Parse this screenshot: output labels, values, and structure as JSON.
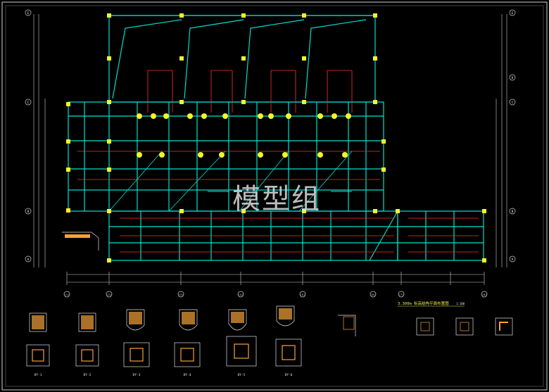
{
  "watermark": "模型组",
  "plan_title": "3.300m 标高结构平面布置图",
  "plan_scale": "1:100",
  "grid_left": [
    "E",
    "C",
    "B",
    "A"
  ],
  "grid_right": [
    "E",
    "D",
    "C",
    "B",
    "A"
  ],
  "grid_bottom": [
    "(1)",
    "(2)",
    "(3)",
    "(4)",
    "(5)",
    "(6)",
    "(7)",
    "(8)"
  ],
  "details": [
    "DY-1",
    "DY-2",
    "DY-3",
    "DY-4",
    "DY-5",
    "DY-6"
  ],
  "colors": {
    "wall": "#00e0d0",
    "column": "#f4f42a",
    "rebar": "#ff3030",
    "dim": "#e0e0e0"
  }
}
